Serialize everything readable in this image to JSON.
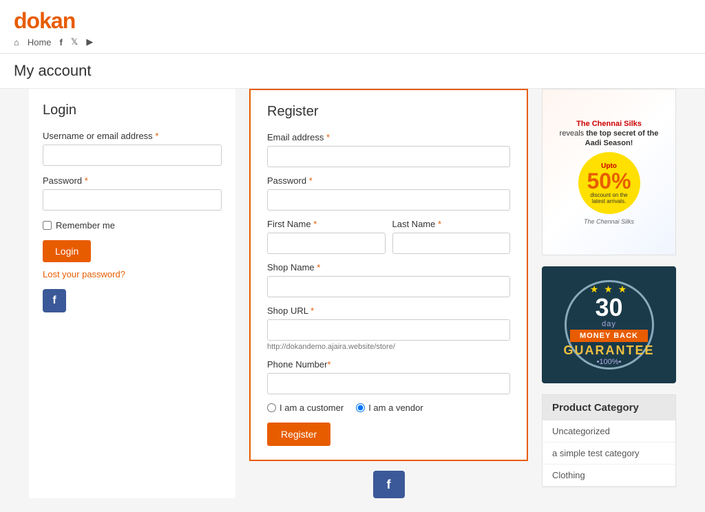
{
  "site": {
    "logo_prefix": "d",
    "logo_main": "okan"
  },
  "nav": {
    "home": "Home",
    "icons": [
      "facebook",
      "twitter",
      "youtube"
    ]
  },
  "page": {
    "title": "My account"
  },
  "login": {
    "heading": "Login",
    "username_label": "Username or email address",
    "password_label": "Password",
    "remember_label": "Remember me",
    "login_button": "Login",
    "lost_password": "Lost your password?"
  },
  "register": {
    "heading": "Register",
    "email_label": "Email address",
    "password_label": "Password",
    "first_name_label": "First Name",
    "last_name_label": "Last Name",
    "shop_name_label": "Shop Name",
    "shop_url_label": "Shop URL",
    "shop_url_hint": "http://dokandemo.ajaira.website/store/",
    "phone_label": "Phone Number",
    "customer_label": "I am a customer",
    "vendor_label": "I am a vendor",
    "register_button": "Register"
  },
  "sidebar": {
    "guarantee": {
      "days": "30",
      "day_label": "day",
      "money_back": "MONEY BACK",
      "guarantee": "GUARANTEE",
      "percent": "•100%•"
    },
    "product_category": {
      "title": "Product Category",
      "items": [
        {
          "label": "Uncategorized"
        },
        {
          "label": "a simple test category"
        },
        {
          "label": "Clothing"
        }
      ]
    }
  },
  "ad": {
    "title": "The Chennai Silks reveals the top secret of the Aadi Season!",
    "percent": "50%",
    "sub": "discount on the latest arrivals.",
    "brand": "The Chennai Silks"
  }
}
